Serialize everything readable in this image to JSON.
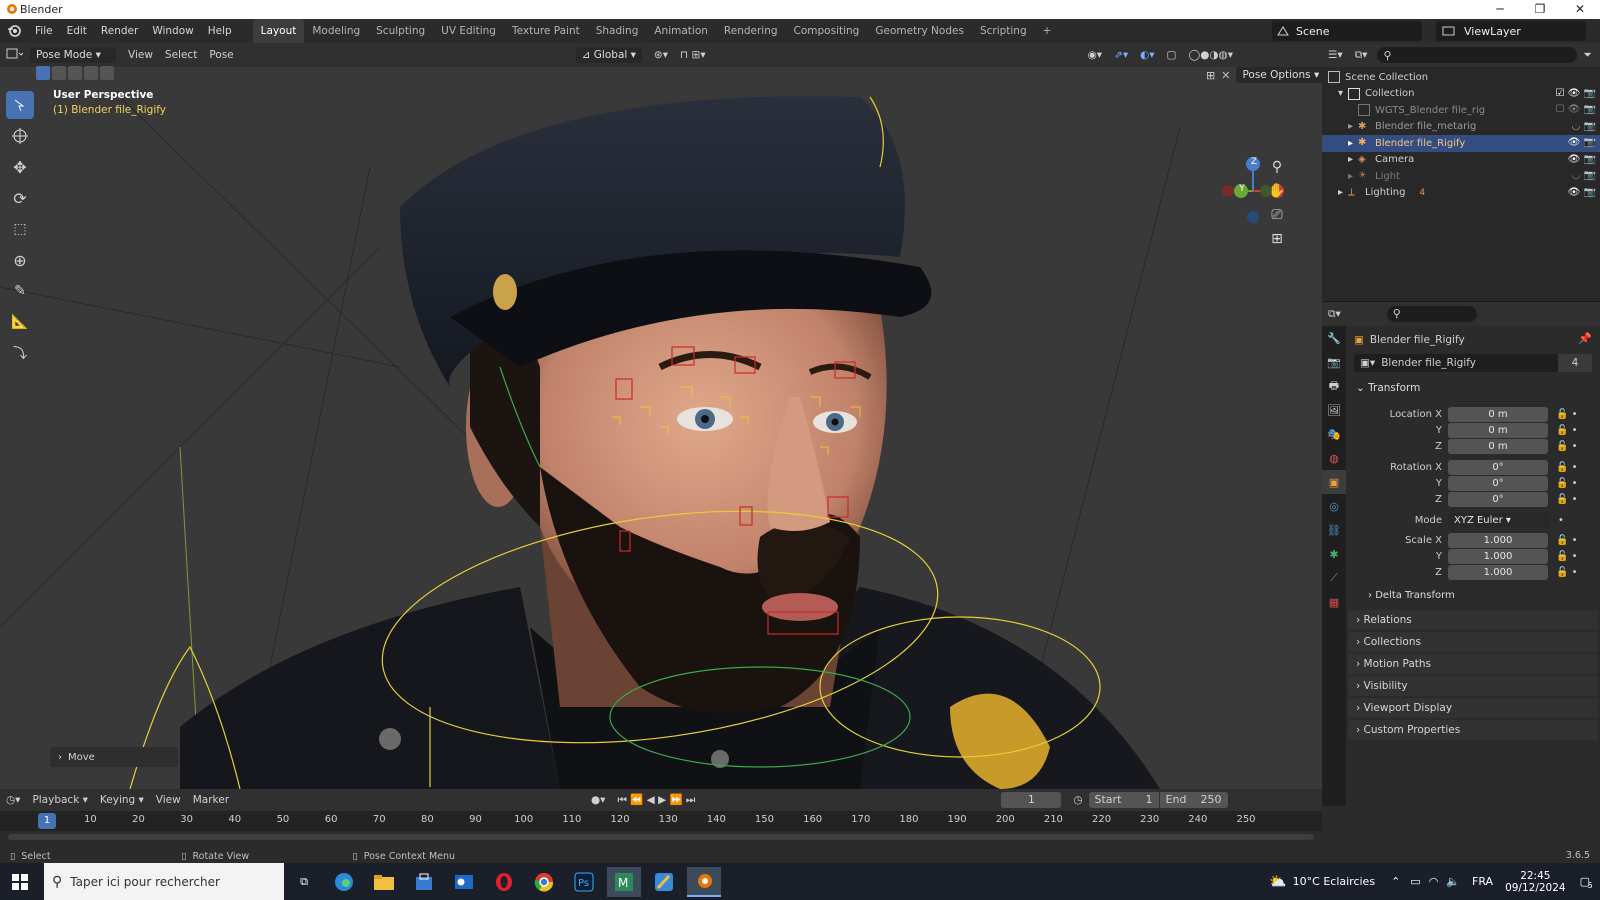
{
  "window": {
    "title": "Blender",
    "min": "─",
    "max": "❐",
    "close": "✕"
  },
  "menubar": {
    "menus": [
      "File",
      "Edit",
      "Render",
      "Window",
      "Help"
    ],
    "workspaces": [
      "Layout",
      "Modeling",
      "Sculpting",
      "UV Editing",
      "Texture Paint",
      "Shading",
      "Animation",
      "Rendering",
      "Compositing",
      "Geometry Nodes",
      "Scripting"
    ],
    "active_workspace": "Layout",
    "add_tab": "+",
    "scene": "Scene",
    "view_layer": "ViewLayer"
  },
  "viewport_header": {
    "mode": "Pose Mode",
    "menus": [
      "View",
      "Select",
      "Pose"
    ],
    "orientation": "Global",
    "pose_options": "Pose Options"
  },
  "viewport": {
    "perspective": "User Perspective",
    "object_label": "(1) Blender file_Rigify",
    "last_op": "Move",
    "gizmo": {
      "z": "Z",
      "y": "Y",
      "x": "X"
    },
    "colors": {
      "bg": "#3a3a3a",
      "selected": "#4772b3",
      "armature": "#e8d23a"
    }
  },
  "outliner": {
    "rows": [
      {
        "label": "Scene Collection"
      },
      {
        "label": "Collection"
      },
      {
        "label": "WGTS_Blender file_rig"
      },
      {
        "label": "Blender file_metarig"
      },
      {
        "label": "Blender file_Rigify"
      },
      {
        "label": "Camera"
      },
      {
        "label": "Light"
      },
      {
        "label": "Lighting"
      }
    ],
    "lighting_count": "4"
  },
  "properties": {
    "object_name": "Blender file_Rigify",
    "datablock_name": "Blender file_Rigify",
    "users": "4",
    "transform_title": "Transform",
    "location": {
      "label": "Location X",
      "x": "0 m",
      "y": "0 m",
      "z": "0 m"
    },
    "rotation": {
      "label": "Rotation X",
      "x": "0°",
      "y": "0°",
      "z": "0°"
    },
    "axis_y": "Y",
    "axis_z": "Z",
    "mode_label": "Mode",
    "mode_value": "XYZ Euler",
    "scale": {
      "label": "Scale X",
      "x": "1.000",
      "y": "1.000",
      "z": "1.000"
    },
    "delta": "Delta Transform",
    "sections": [
      "Relations",
      "Collections",
      "Motion Paths",
      "Visibility",
      "Viewport Display",
      "Custom Properties"
    ]
  },
  "timeline": {
    "menus": [
      "Playback",
      "Keying",
      "View",
      "Marker"
    ],
    "current_frame": "1",
    "start_label": "Start",
    "start": "1",
    "end_label": "End",
    "end": "250",
    "ticks": [
      "10",
      "20",
      "30",
      "40",
      "50",
      "60",
      "70",
      "80",
      "90",
      "100",
      "110",
      "120",
      "130",
      "140",
      "150",
      "160",
      "170",
      "180",
      "190",
      "200",
      "210",
      "220",
      "230",
      "240",
      "250"
    ]
  },
  "statusbar": {
    "select": "Select",
    "rotate": "Rotate View",
    "context": "Pose Context Menu",
    "version": "3.6.5"
  },
  "taskbar": {
    "search": "Taper ici pour rechercher",
    "weather": "10°C  Eclaircies",
    "lang": "FRA",
    "time": "22:45",
    "date": "09/12/2024",
    "notif": "5"
  }
}
